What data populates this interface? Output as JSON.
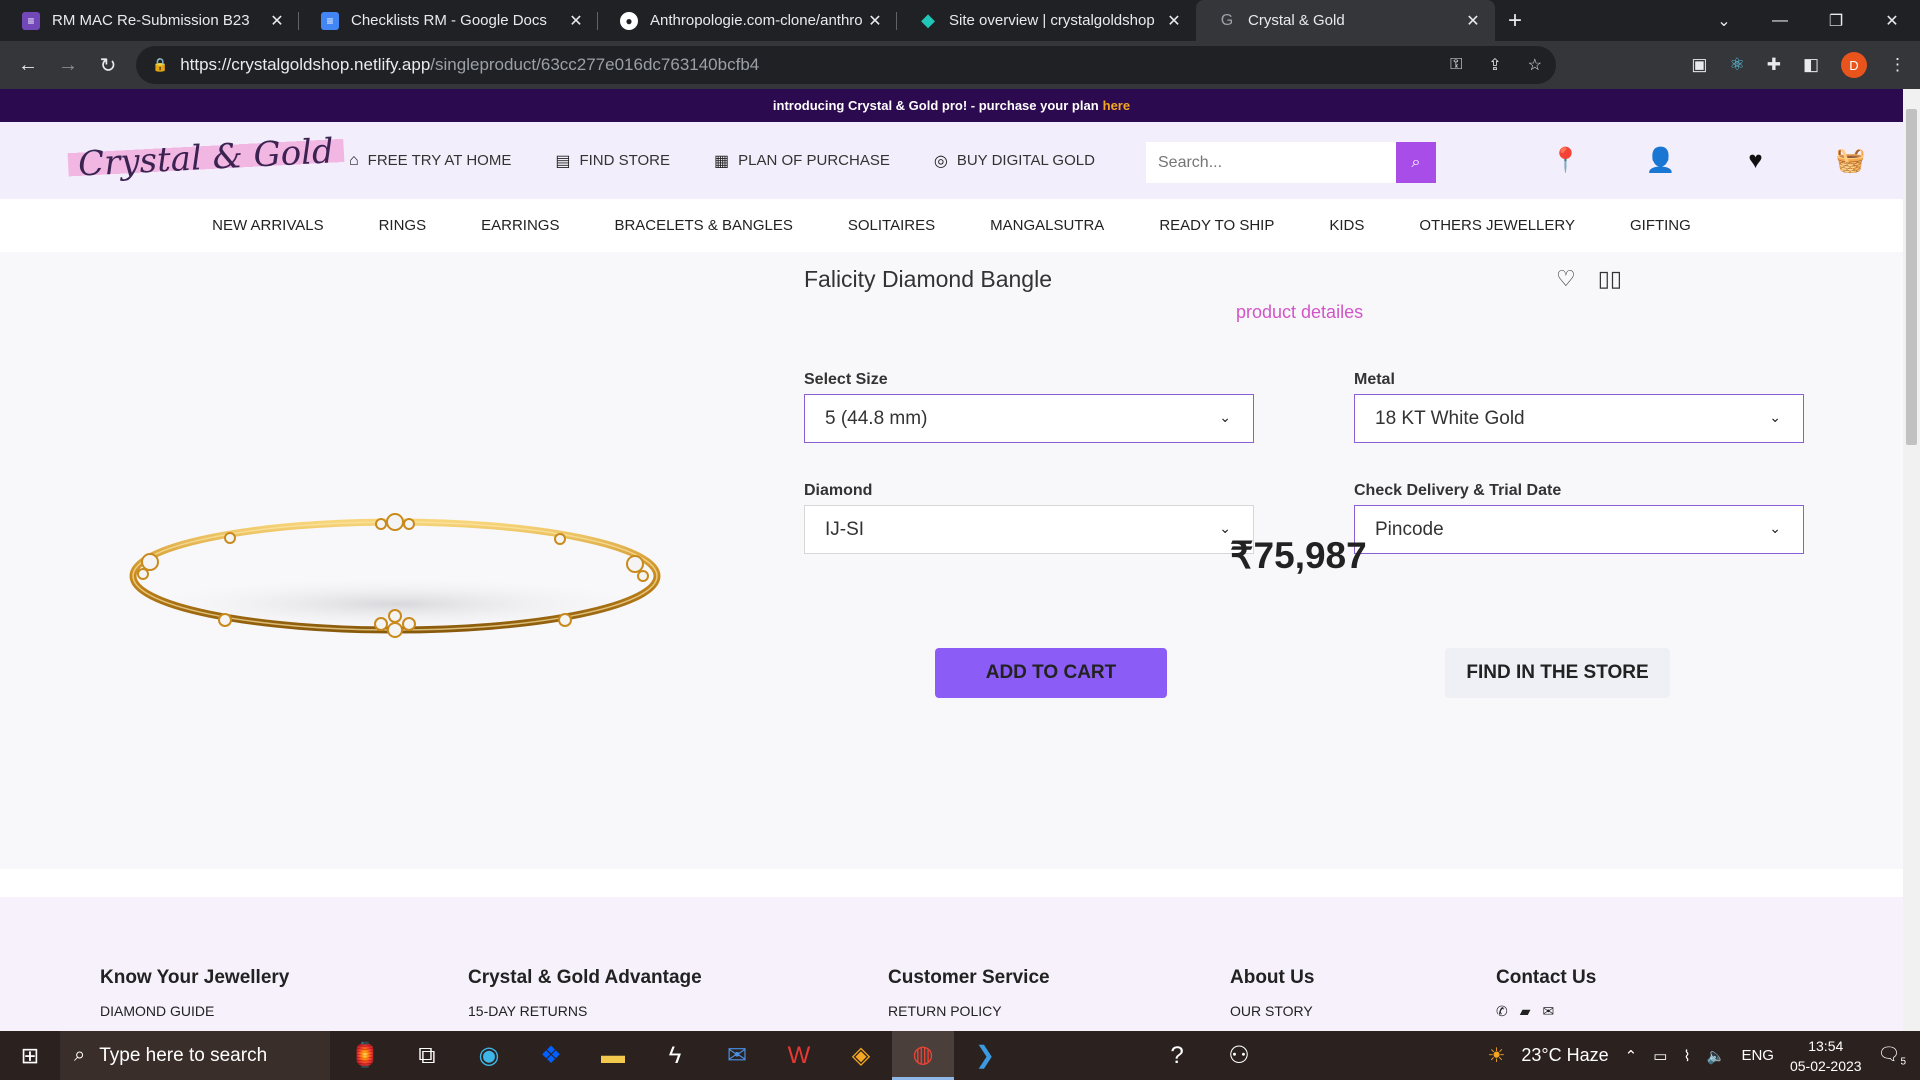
{
  "browser": {
    "tabs": [
      {
        "title": "RM MAC Re-Submission B23",
        "icon": "forms-icon",
        "color": "#7248b9"
      },
      {
        "title": "Checklists RM - Google Docs",
        "icon": "docs-icon",
        "color": "#4285f4"
      },
      {
        "title": "Anthropologie.com-clone/anthro",
        "icon": "github-icon",
        "color": "#ffffff"
      },
      {
        "title": "Site overview | crystalgoldshop",
        "icon": "netlify-icon",
        "color": "#20c6b7"
      },
      {
        "title": "Crystal & Gold",
        "icon": "globe-icon",
        "color": "#9aa0a6",
        "active": true
      }
    ],
    "url_host": "https://crystalgoldshop.netlify.app",
    "url_path": "/singleproduct/63cc277e016dc763140bcfb4",
    "profile_initial": "D"
  },
  "promo": {
    "text": "introducing Crystal & Gold pro! - purchase your plan",
    "link": "here"
  },
  "header": {
    "logo": "Crystal & Gold",
    "links": [
      {
        "label": "FREE TRY AT HOME",
        "icon": "home-icon"
      },
      {
        "label": "FIND STORE",
        "icon": "store-icon"
      },
      {
        "label": "PLAN OF PURCHASE",
        "icon": "calendar-icon"
      },
      {
        "label": "BUY DIGITAL GOLD",
        "icon": "coins-icon"
      }
    ],
    "search_placeholder": "Search..."
  },
  "categories": [
    "NEW ARRIVALS",
    "RINGS",
    "EARRINGS",
    "BRACELETS & BANGLES",
    "SOLITAIRES",
    "MANGALSUTRA",
    "READY TO SHIP",
    "KIDS",
    "OTHERS JEWELLERY",
    "GIFTING"
  ],
  "product": {
    "title": "Falicity Diamond Bangle",
    "details_link": "product detailes",
    "size_label": "Select Size",
    "size_value": "5 (44.8 mm)",
    "metal_label": "Metal",
    "metal_value": "18 KT White Gold",
    "diamond_label": "Diamond",
    "diamond_value": "IJ-SI",
    "delivery_label": "Check Delivery & Trial Date",
    "delivery_value": "Pincode",
    "price": "₹75,987",
    "add_to_cart": "ADD TO CART",
    "find_in_store": "FIND IN THE STORE"
  },
  "footer": {
    "columns": [
      {
        "heading": "Know Your Jewellery",
        "first_item": "DIAMOND GUIDE"
      },
      {
        "heading": "Crystal & Gold Advantage",
        "first_item": "15-DAY RETURNS"
      },
      {
        "heading": "Customer Service",
        "first_item": "RETURN POLICY"
      },
      {
        "heading": "About Us",
        "first_item": "OUR STORY"
      },
      {
        "heading": "Contact Us",
        "first_item": ""
      }
    ]
  },
  "taskbar": {
    "search_placeholder": "Type here to search",
    "weather": "23°C  Haze",
    "lang": "ENG",
    "time": "13:54",
    "date": "05-02-2023",
    "notifications": "5"
  }
}
